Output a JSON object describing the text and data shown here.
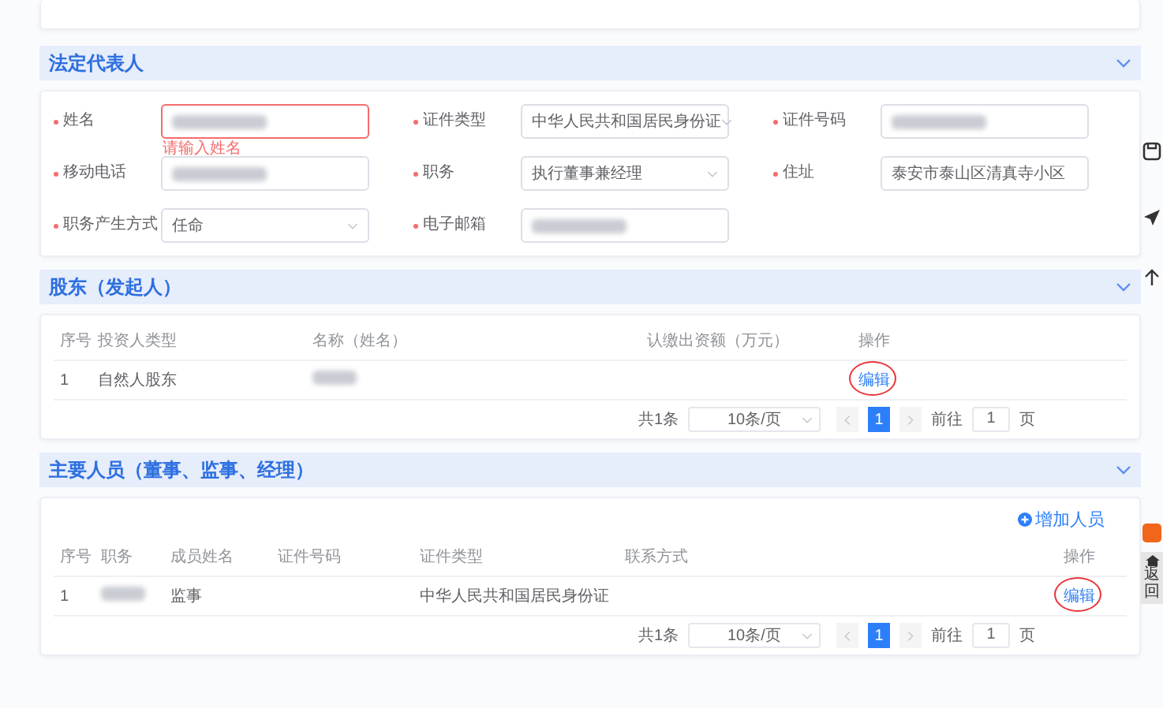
{
  "legal_rep": {
    "title": "法定代表人",
    "fields": [
      {
        "label": "姓名",
        "required": true,
        "kind": "input",
        "blurred": true,
        "error": "请输入姓名"
      },
      {
        "label": "证件类型",
        "required": true,
        "kind": "select",
        "value": "中华人民共和国居民身份证"
      },
      {
        "label": "证件号码",
        "required": true,
        "kind": "input",
        "blurred": true
      },
      {
        "label": "移动电话",
        "required": true,
        "kind": "input",
        "blurred": true
      },
      {
        "label": "职务",
        "required": true,
        "kind": "select",
        "value": "执行董事兼经理"
      },
      {
        "label": "住址",
        "required": true,
        "kind": "input",
        "value": "泰安市泰山区清真寺小区"
      },
      {
        "label": "职务产生方式",
        "required": true,
        "kind": "select",
        "value": "任命"
      },
      {
        "label": "电子邮箱",
        "required": true,
        "kind": "input",
        "blurred": true
      }
    ]
  },
  "shareholders": {
    "title": "股东（发起人）",
    "columns": [
      "序号",
      "投资人类型",
      "名称（姓名）",
      "认缴出资额（万元）",
      "操作"
    ],
    "rows": [
      {
        "index": "1",
        "type": "自然人股东",
        "name_blurred": true,
        "action": "编辑",
        "action_circled": true
      }
    ],
    "pagination": {
      "total": "共1条",
      "page_size": "10条/页",
      "pages": [
        {
          "label": "1",
          "selected": true
        }
      ],
      "goto_label": "前往",
      "goto_value": "1",
      "goto_suffix": "页"
    }
  },
  "members": {
    "title": "主要人员（董事、监事、经理）",
    "add_button": "增加人员",
    "columns": [
      "序号",
      "职务",
      "成员姓名",
      "证件号码",
      "证件类型",
      "联系方式",
      "操作"
    ],
    "rows": [
      {
        "index": "1",
        "position_blurred": true,
        "name": "监事",
        "id_type": "中华人民共和国居民身份证",
        "action": "编辑",
        "action_circled": true
      }
    ],
    "pagination": {
      "total": "共1条",
      "page_size": "10条/页",
      "pages": [
        {
          "label": "1",
          "selected": true
        }
      ],
      "goto_label": "前往",
      "goto_value": "1",
      "goto_suffix": "页"
    }
  },
  "side_tools": {
    "home_label": "返回"
  }
}
